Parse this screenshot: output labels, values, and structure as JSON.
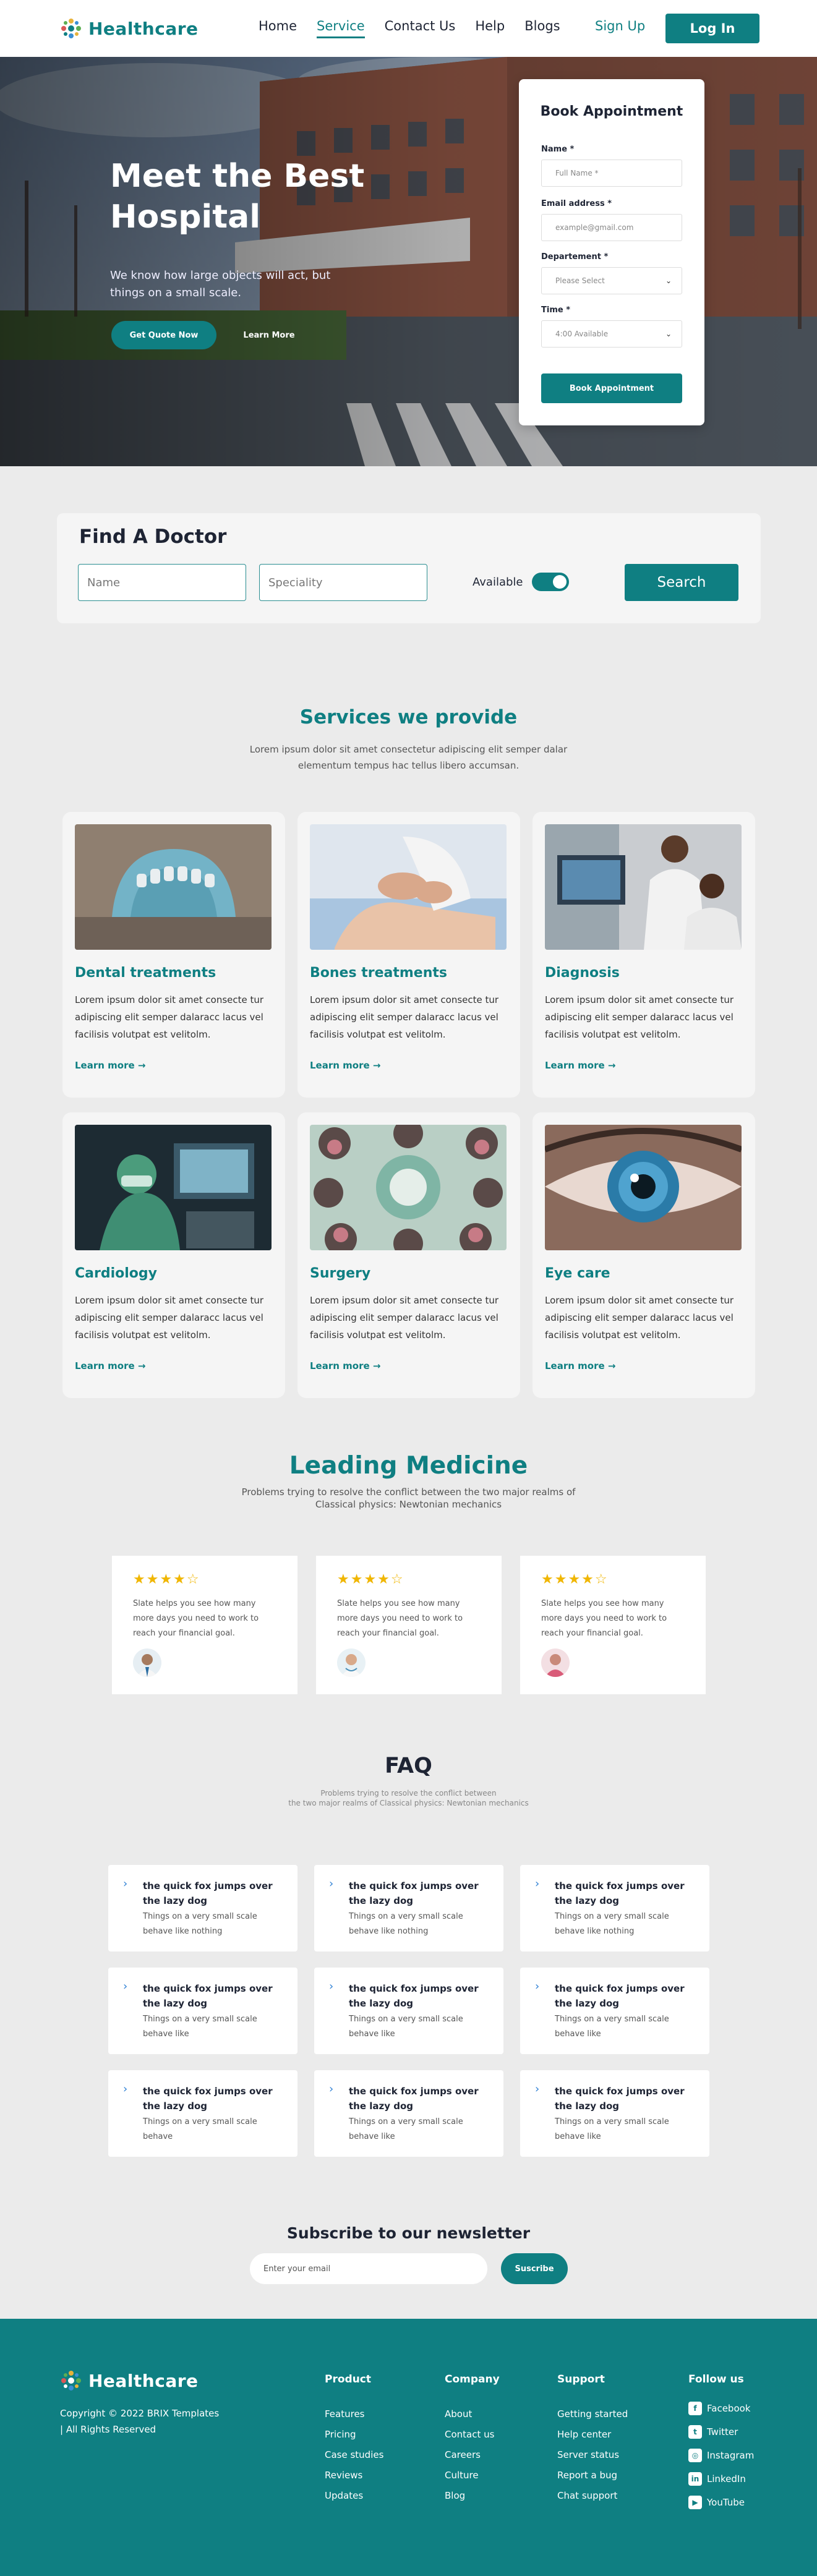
{
  "nav": {
    "logo": "Healthcare",
    "links": [
      "Home",
      "Service",
      "Contact Us",
      "Help",
      "Blogs"
    ],
    "active": "Service",
    "signup": "Sign Up",
    "login": "Log In"
  },
  "hero": {
    "title": "Meet the Best Hospital",
    "subtitle": "We know how large objects will act, but things on a small scale.",
    "quote_button": "Get Quote Now",
    "learn_button": "Learn More"
  },
  "booking": {
    "title": "Book Appointment",
    "name_label": "Name *",
    "name_placeholder": "Full Name *",
    "email_label": "Email address *",
    "email_placeholder": "example@gmail.com",
    "department_label": "Departement *",
    "department_value": "Please Select",
    "time_label": "Time *",
    "time_value": "4:00 Available",
    "submit": "Book Appointment"
  },
  "find": {
    "title": "Find A Doctor",
    "name_placeholder": "Name",
    "speciality_placeholder": "Speciality",
    "available_label": "Available",
    "search_button": "Search"
  },
  "services": {
    "title": "Services we provide",
    "subtitle_1": "Lorem ipsum dolor sit amet consectetur adipiscing elit semper dalar",
    "subtitle_2": "elementum tempus hac tellus libero accumsan.",
    "items": [
      {
        "title": "Dental treatments",
        "desc": "Lorem ipsum dolor sit amet consecte tur adipiscing elit semper dalaracc lacus vel facilisis volutpat est velitolm.",
        "link": "Learn more"
      },
      {
        "title": "Bones treatments",
        "desc": "Lorem ipsum dolor sit amet consecte tur adipiscing elit semper dalaracc lacus vel facilisis volutpat est velitolm.",
        "link": "Learn more"
      },
      {
        "title": "Diagnosis",
        "desc": "Lorem ipsum dolor sit amet consecte tur adipiscing elit semper dalaracc lacus vel facilisis volutpat est velitolm.",
        "link": "Learn more"
      },
      {
        "title": "Cardiology",
        "desc": "Lorem ipsum dolor sit amet consecte tur adipiscing elit semper dalaracc lacus vel facilisis volutpat est velitolm.",
        "link": "Learn more"
      },
      {
        "title": "Surgery",
        "desc": "Lorem ipsum dolor sit amet consecte tur adipiscing elit semper dalaracc lacus vel facilisis volutpat est velitolm.",
        "link": "Learn more"
      },
      {
        "title": "Eye care",
        "desc": "Lorem ipsum dolor sit amet consecte tur adipiscing elit semper dalaracc lacus vel facilisis volutpat est velitolm.",
        "link": "Learn more"
      }
    ]
  },
  "leading": {
    "title": "Leading Medicine",
    "subtitle_1": "Problems trying to resolve the conflict between the two major realms of",
    "subtitle_2": "Classical physics: Newtonian mechanics",
    "testimonials": [
      {
        "rating": 4,
        "stars": "★★★★☆",
        "text": "Slate helps you see how many more days you need to work to reach your financial goal."
      },
      {
        "rating": 4,
        "stars": "★★★★☆",
        "text": "Slate helps you see how many more days you need to work to reach your financial goal."
      },
      {
        "rating": 4,
        "stars": "★★★★☆",
        "text": "Slate helps you see how many more days you need to work to reach your financial goal."
      }
    ]
  },
  "faq": {
    "title": "FAQ",
    "subtitle_1": "Problems trying to resolve the conflict between",
    "subtitle_2": "the two major realms of Classical physics: Newtonian mechanics",
    "items": [
      {
        "q": "the quick fox jumps over the lazy dog",
        "a": "Things on a very small scale behave like nothing"
      },
      {
        "q": "the quick fox jumps over the lazy dog",
        "a": "Things on a very small scale behave like nothing"
      },
      {
        "q": "the quick fox jumps over the lazy dog",
        "a": "Things on a very small scale behave like nothing"
      },
      {
        "q": "the quick fox jumps over the lazy dog",
        "a": "Things on a very small scale behave like"
      },
      {
        "q": "the quick fox jumps over the lazy dog",
        "a": "Things on a very small scale behave like"
      },
      {
        "q": "the quick fox jumps over the lazy dog",
        "a": "Things on a very small scale behave like"
      },
      {
        "q": "the quick fox jumps over the lazy dog",
        "a": "Things on a very small scale behave"
      },
      {
        "q": "the quick fox jumps over the lazy dog",
        "a": "Things on a very small scale behave like"
      },
      {
        "q": "the quick fox jumps over the lazy dog",
        "a": "Things on a very small scale behave like"
      }
    ]
  },
  "newsletter": {
    "title": "Subscribe to our newsletter",
    "placeholder": "Enter your email",
    "button": "Suscribe"
  },
  "footer": {
    "logo": "Healthcare",
    "copyright_1": "Copyright © 2022 BRIX Templates",
    "copyright_2": "| All Rights Reserved",
    "product": {
      "title": "Product",
      "links": [
        "Features",
        "Pricing",
        "Case studies",
        "Reviews",
        "Updates"
      ]
    },
    "company": {
      "title": "Company",
      "links": [
        "About",
        "Contact us",
        "Careers",
        "Culture",
        "Blog"
      ]
    },
    "support": {
      "title": "Support",
      "links": [
        "Getting started",
        "Help center",
        "Server status",
        "Report a bug",
        "Chat support"
      ]
    },
    "follow": {
      "title": "Follow us",
      "links": [
        "Facebook",
        "Twitter",
        "Instagram",
        "LinkedIn",
        "YouTube"
      ]
    }
  },
  "colors": {
    "brand": "#0f7f82",
    "dark": "#1e2434",
    "star": "#f0b600",
    "page_bg": "#ebebeb"
  }
}
